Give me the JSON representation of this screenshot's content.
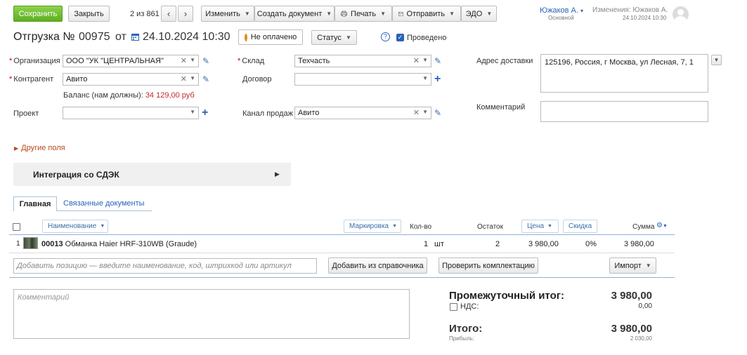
{
  "toolbar": {
    "save": "Сохранить",
    "close": "Закрыть",
    "pager": "2 из 861",
    "change": "Изменить",
    "create_doc": "Создать документ",
    "print": "Печать",
    "send": "Отправить",
    "edo": "ЭДО"
  },
  "user": {
    "name": "Южаков А.",
    "role": "Основной",
    "changes_label": "Изменения: Южаков А.",
    "changes_date": "24.10.2024 10:30"
  },
  "doc": {
    "title": "Отгрузка №",
    "number": "00975",
    "from": "от",
    "date": "24.10.2024 10:30",
    "payment_status": "Не оплачено",
    "status": "Статус",
    "help": "?",
    "posted": "Проведено"
  },
  "form": {
    "org_label": "Организация",
    "org_value": "ООО \"УК \"ЦЕНТРАЛЬНАЯ\"",
    "contractor_label": "Контрагент",
    "contractor_value": "Авито",
    "balance_label": "Баланс (нам должны):",
    "balance_value": "34 129,00 руб",
    "project_label": "Проект",
    "project_value": "",
    "warehouse_label": "Склад",
    "warehouse_value": "Техчасть",
    "contract_label": "Договор",
    "contract_value": "",
    "channel_label": "Канал продаж",
    "channel_value": "Авито",
    "address_label": "Адрес доставки",
    "address_value": "125196, Россия, г Москва, ул Лесная, 7, 1",
    "comment_label": "Комментарий",
    "comment_value": "",
    "other_fields": "Другие поля"
  },
  "integration": {
    "title": "Интеграция со СДЭК"
  },
  "tabs": {
    "main": "Главная",
    "related": "Связанные документы"
  },
  "table": {
    "headers": {
      "name": "Наименование",
      "marking": "Маркировка",
      "qty": "Кол-во",
      "stock": "Остаток",
      "price": "Цена",
      "discount": "Скидка",
      "sum": "Сумма"
    },
    "rows": [
      {
        "index": "1",
        "code": "00013",
        "name": "Обманка Haier HRF-310WB (Graude)",
        "qty": "1",
        "unit": "шт",
        "stock": "2",
        "price": "3 980,00",
        "discount": "0%",
        "sum": "3 980,00"
      }
    ],
    "add_placeholder": "Добавить позицию — введите наименование, код, штрихкод или артикул",
    "add_from_catalog": "Добавить из справочника",
    "check_kit": "Проверить комплектацию",
    "import": "Импорт"
  },
  "footer": {
    "comment_placeholder": "Комментарий",
    "subtotal_label": "Промежуточный итог:",
    "subtotal_value": "3 980,00",
    "vat_label": "НДС:",
    "vat_value": "0,00",
    "total_label": "Итого:",
    "total_value": "3 980,00",
    "profit_label": "Прибыль:",
    "profit_value": "2 030,00"
  },
  "colors": {
    "accent_green": "#6cbd2a",
    "link_blue": "#2a63b8",
    "required_red": "#cc0000",
    "balance_red": "#c62828",
    "orange": "#e28c1c"
  }
}
